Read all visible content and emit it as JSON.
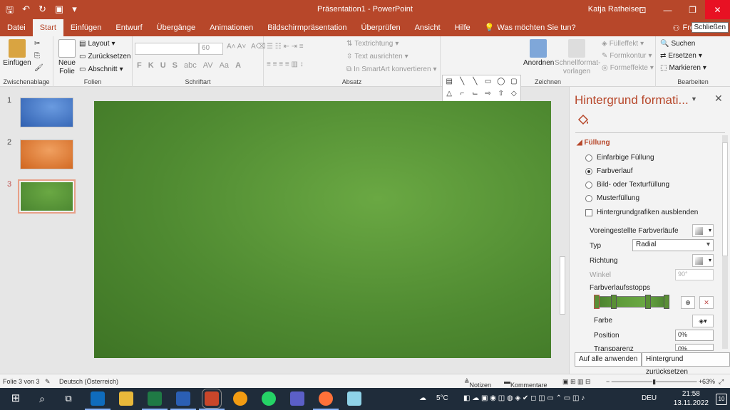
{
  "app": {
    "doc_title": "Präsentation1  -  PowerPoint",
    "user": "Katja Ratheiser",
    "tooltip": "Schließen",
    "share_label": "Fre"
  },
  "tabs": [
    "Datei",
    "Start",
    "Einfügen",
    "Entwurf",
    "Übergänge",
    "Animationen",
    "Bildschirmpräsentation",
    "Überprüfen",
    "Ansicht",
    "Hilfe"
  ],
  "tell_me": "Was möchten Sie tun?",
  "ribbon": {
    "clipboard": {
      "paste": "Einfügen",
      "label": "Zwischenablage"
    },
    "slides": {
      "new_slide": "Neue Folie",
      "layout": "Layout",
      "reset": "Zurücksetzen",
      "section": "Abschnitt",
      "label": "Folien"
    },
    "font": {
      "font_size": "60",
      "bold": "F",
      "italic": "K",
      "underline": "U",
      "strike": "S",
      "shadow": "abc",
      "spacing": "AV",
      "case": "Aa",
      "label": "Schriftart"
    },
    "paragraph": {
      "text_direction": "Textrichtung",
      "align_text": "Text ausrichten",
      "smartart": "In SmartArt konvertieren",
      "label": "Absatz"
    },
    "drawing": {
      "arrange": "Anordnen",
      "quick_styles": "Schnellformat-vorlagen",
      "fill": "Fülleffekt",
      "outline": "Formkontur",
      "effects": "Formeffekte",
      "label": "Zeichnen"
    },
    "editing": {
      "find": "Suchen",
      "replace": "Ersetzen",
      "select": "Markieren",
      "label": "Bearbeiten"
    }
  },
  "slides": {
    "numbers": [
      "1",
      "2",
      "3"
    ],
    "colors": [
      "#3a6fc4",
      "#e07a2e",
      "#5a9a38"
    ],
    "selected_index": 3
  },
  "pane": {
    "title": "Hintergrund formati...",
    "section": "Füllung",
    "options": [
      "Einfarbige Füllung",
      "Farbverlauf",
      "Bild- oder Texturfüllung",
      "Musterfüllung"
    ],
    "selected_option": "Farbverlauf",
    "hide_graphics": "Hintergrundgrafiken ausblenden",
    "preset": "Voreingestellte Farbverläufe",
    "type_label": "Typ",
    "type_value": "Radial",
    "direction": "Richtung",
    "angle": "Winkel",
    "angle_value": "90°",
    "stops": "Farbverlaufsstopps",
    "color": "Farbe",
    "position": "Position",
    "position_value": "0%",
    "transparency": "Transparenz",
    "transparency_value": "0%",
    "apply_all": "Auf alle anwenden",
    "reset_bg": "Hintergrund zurücksetzen"
  },
  "status": {
    "slide_info": "Folie 3 von 3",
    "language": "Deutsch (Österreich)",
    "notes": "Notizen",
    "comments": "Kommentare",
    "zoom": "63%"
  },
  "taskbar": {
    "weather": "5°C",
    "lang": "DEU",
    "time": "21:58",
    "date": "13.11.2022",
    "notifications": "10"
  }
}
